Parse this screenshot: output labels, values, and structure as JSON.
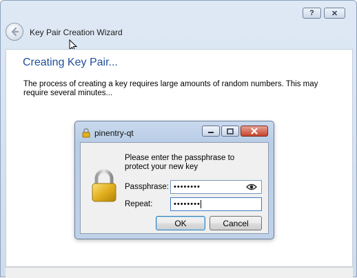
{
  "window": {
    "title": "Key Pair Creation Wizard",
    "caption_buttons": {
      "help": "?",
      "close": "✕"
    }
  },
  "page": {
    "heading": "Creating Key Pair...",
    "description": "The process of creating a key requires large amounts of random numbers. This may require several minutes..."
  },
  "dialog": {
    "title": "pinentry-qt",
    "prompt": "Please enter the passphrase to protect your new key",
    "passphrase_label": "Passphrase:",
    "passphrase_value": "••••••••",
    "repeat_label": "Repeat:",
    "repeat_value": "••••••••",
    "ok_label": "OK",
    "cancel_label": "Cancel"
  },
  "icons": {
    "back": "back-arrow-icon",
    "lock": "lock-icon",
    "eye": "eye-icon"
  },
  "colors": {
    "heading": "#1f4e99",
    "close_button": "#c6442c",
    "lock_gold": "#e2b01f"
  }
}
